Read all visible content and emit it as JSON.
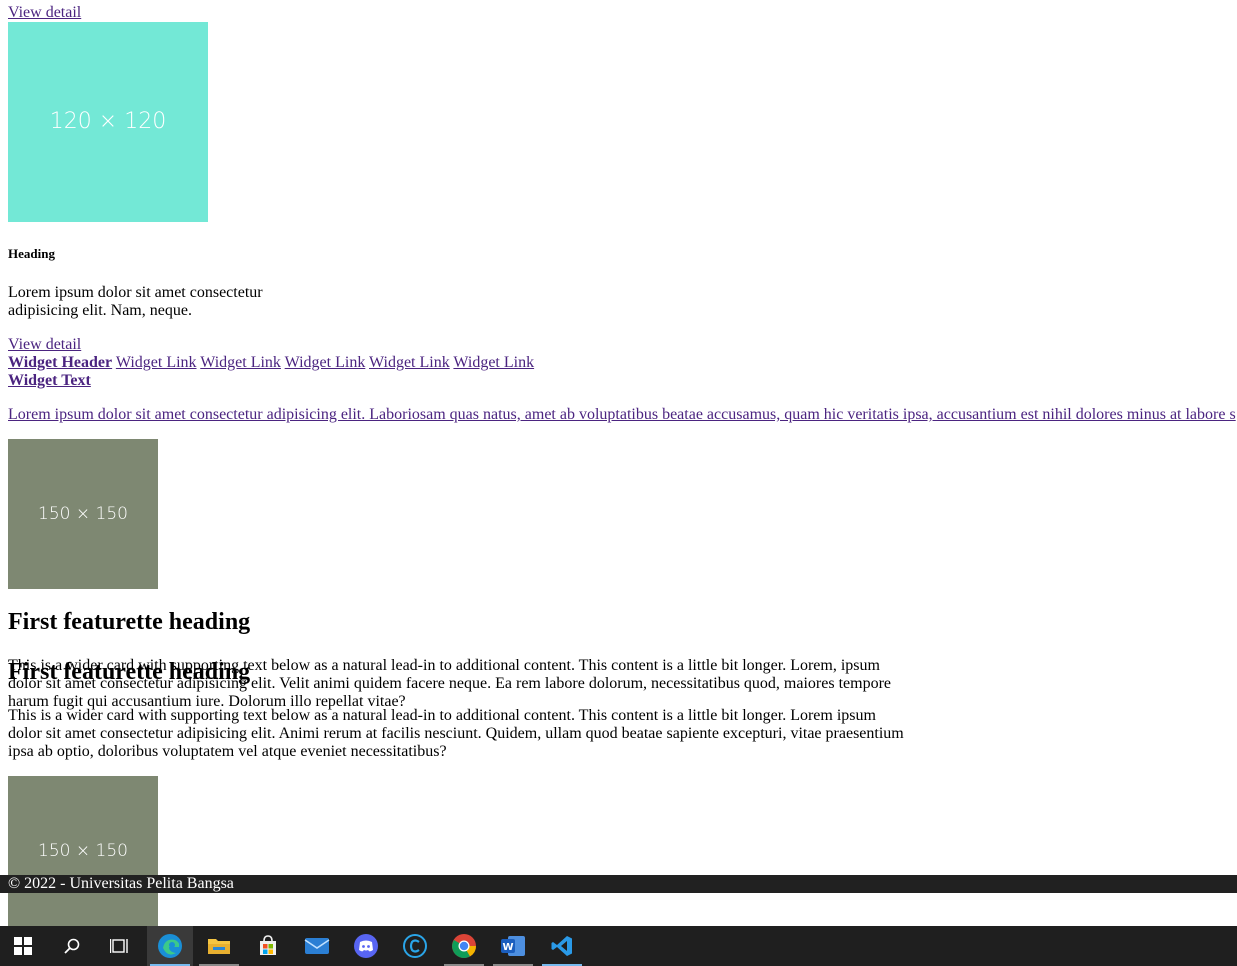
{
  "top_link": "View detail",
  "placeholder_teal": "120 × 120",
  "card": {
    "heading": "Heading",
    "text_line1": "Lorem ipsum dolor sit amet consectetur",
    "text_line2": "adipisicing elit. Nam, neque.",
    "link": "View detail"
  },
  "widget": {
    "header": "Widget Header",
    "links": [
      "Widget Link",
      "Widget Link",
      "Widget Link",
      "Widget Link",
      "Widget Link"
    ],
    "text_title": "Widget Text",
    "paragraph": "Lorem ipsum dolor sit amet consectetur adipisicing elit. Laboriosam quas natus, amet ab voluptatibus beatae accusamus, quam hic veritatis ipsa, accusantium est nihil dolores minus at labore s"
  },
  "placeholder_olive": "150 × 150",
  "featurette": {
    "heading1": "First featurette heading",
    "p1_line1": "This is a wider card with supporting text below as a natural lead-in to additional content. This content is a little bit longer. Lorem, ipsum",
    "p1_line2": "dolor sit amet consectetur adipisicing elit. Velit animi quidem facere neque. Ea rem labore dolorum, necessitatibus quod, maiores tempore",
    "p1_line3": "harum fugit qui accusantium iure. Dolorum illo repellat vitae?",
    "heading2": "First featurette heading",
    "p2_line1": "This is a wider card with supporting text below as a natural lead-in to additional content. This content is a little bit longer. Lorem ipsum",
    "p2_line2": "dolor sit amet consectetur adipisicing elit. Animi rerum at facilis nesciunt. Quidem, ullam quod beatae sapiente excepturi, vitae praesentium",
    "p2_line3": "ipsa ab optio, doloribus voluptatem vel atque eveniet necessitatibus?"
  },
  "placeholder_olive2": "150 × 150",
  "footer_text": "© 2022 - Universitas Pelita Bangsa",
  "taskbar": {
    "icons": [
      "windows-start-icon",
      "search-icon",
      "task-view-icon",
      "edge-browser-icon",
      "file-explorer-icon",
      "microsoft-store-icon",
      "mail-icon",
      "discord-icon",
      "ccleaner-icon",
      "chrome-icon",
      "word-icon",
      "vscode-icon"
    ],
    "accent": "#76b9ed"
  },
  "colors": {
    "link": "#4b2480",
    "placeholder_teal": "#73e8d6",
    "placeholder_olive": "#7e8872",
    "footer_bg": "#212121",
    "taskbar_bg": "#1f1f1f"
  }
}
